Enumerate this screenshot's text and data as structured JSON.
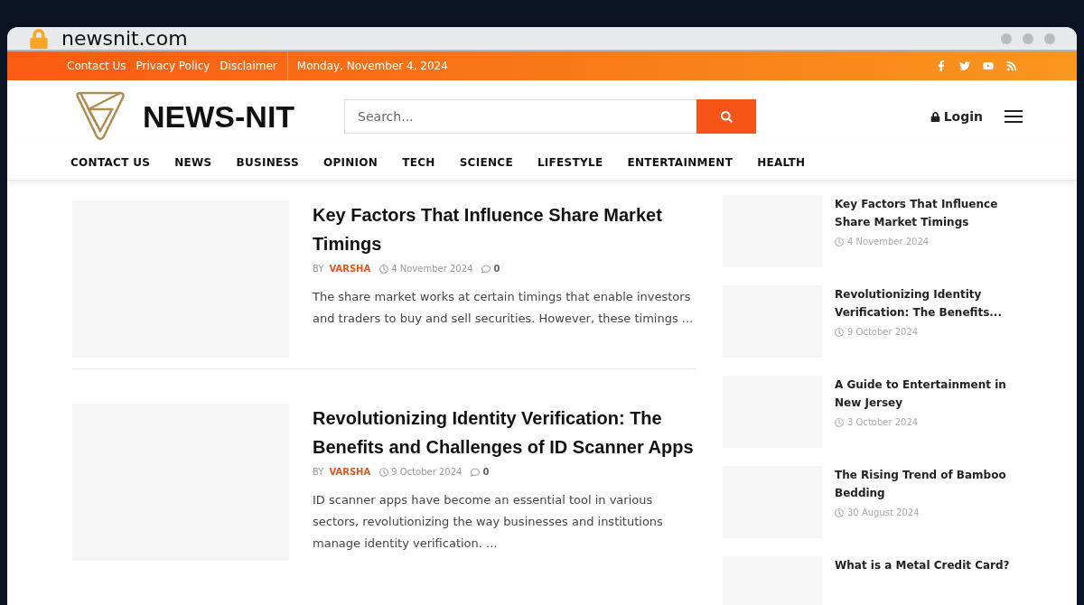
{
  "browser": {
    "url": "newsnit.com"
  },
  "topbar": {
    "links": [
      "Contact Us",
      "Privacy Policy",
      "Disclaimer"
    ],
    "date": "Monday, November 4, 2024"
  },
  "header": {
    "logo_text": "NEWS-NIT",
    "search": {
      "placeholder": "Search..."
    },
    "login": "Login"
  },
  "nav": [
    "CONTACT US",
    "NEWS",
    "BUSINESS",
    "OPINION",
    "TECH",
    "SCIENCE",
    "LIFESTYLE",
    "ENTERTAINMENT",
    "HEALTH"
  ],
  "articles": [
    {
      "title": "Key Factors That Influence Share Market Timings",
      "by": "BY",
      "author": "VARSHA",
      "date": "4 November 2024",
      "comments": "0",
      "excerpt": "The share market works at certain timings that enable investors and traders to buy and sell securities. However, these timings ..."
    },
    {
      "title": "Revolutionizing Identity Verification: The Benefits and Challenges of ID Scanner Apps",
      "by": "BY",
      "author": "VARSHA",
      "date": "9 October 2024",
      "comments": "0",
      "excerpt": "ID scanner apps have become an essential tool in various sectors, revolutionizing the way businesses and institutions manage identity verification. ..."
    }
  ],
  "sidebar": [
    {
      "title": "Key Factors That Influence Share Market Timings",
      "date": "4 November 2024"
    },
    {
      "title": "Revolutionizing Identity Verification: The Benefits...",
      "date": "9 October 2024"
    },
    {
      "title": "A Guide to Entertainment in New Jersey",
      "date": "3 October 2024"
    },
    {
      "title": "The Rising Trend of Bamboo Bedding",
      "date": "30 August 2024"
    },
    {
      "title": "What is a Metal Credit Card?"
    }
  ]
}
